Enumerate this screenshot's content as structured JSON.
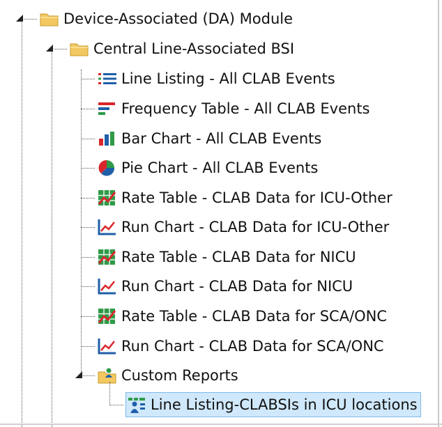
{
  "tree": {
    "root": {
      "label": "Device-Associated (DA) Module",
      "icon": "folder-icon",
      "children": [
        {
          "label": "Central Line-Associated BSI",
          "icon": "folder-icon",
          "children": [
            {
              "label": "Line Listing - All CLAB Events",
              "icon": "line-listing-icon"
            },
            {
              "label": "Frequency Table - All CLAB Events",
              "icon": "frequency-table-icon"
            },
            {
              "label": "Bar Chart - All CLAB Events",
              "icon": "bar-chart-icon"
            },
            {
              "label": "Pie Chart - All CLAB Events",
              "icon": "pie-chart-icon"
            },
            {
              "label": "Rate Table - CLAB Data for ICU-Other",
              "icon": "rate-table-icon"
            },
            {
              "label": "Run Chart - CLAB Data for ICU-Other",
              "icon": "run-chart-icon"
            },
            {
              "label": "Rate Table - CLAB Data for NICU",
              "icon": "rate-table-icon"
            },
            {
              "label": "Run Chart - CLAB Data for NICU",
              "icon": "run-chart-icon"
            },
            {
              "label": "Rate Table - CLAB Data for SCA/ONC",
              "icon": "rate-table-icon"
            },
            {
              "label": "Run Chart - CLAB Data for SCA/ONC",
              "icon": "run-chart-icon"
            },
            {
              "label": "Custom Reports",
              "icon": "custom-reports-folder-icon",
              "children": [
                {
                  "label": "Line Listing-CLABSIs in ICU locations",
                  "icon": "custom-line-listing-icon",
                  "selected": true
                }
              ]
            }
          ]
        }
      ]
    }
  },
  "colors": {
    "selected_bg": "#cfe8fb",
    "selected_border": "#7db9e8",
    "folder": "#f3c860",
    "red": "#d9262b",
    "blue": "#1f5fa8",
    "green": "#2f9a48"
  }
}
